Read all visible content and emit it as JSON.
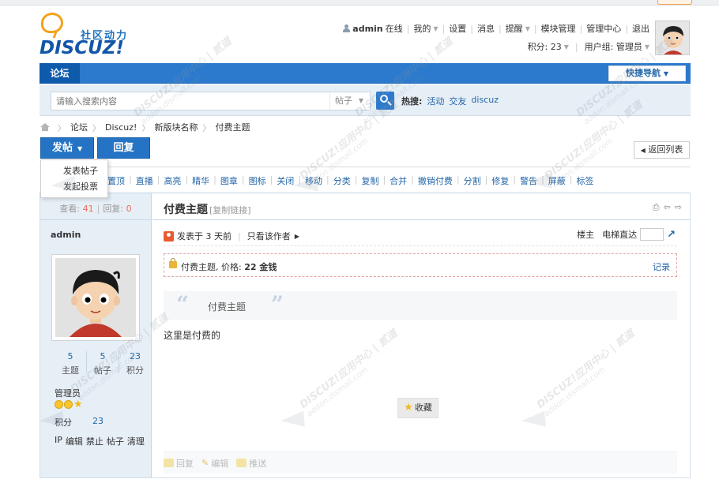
{
  "logo": {
    "cn": "社区动力",
    "en": "DISCUZ!"
  },
  "userbar": {
    "username": "admin",
    "online": "在线",
    "my": "我的",
    "settings": "设置",
    "messages": "消息",
    "reminders": "提醒",
    "module_admin": "模块管理",
    "admin_center": "管理中心",
    "logout": "退出",
    "credits": "积分: 23",
    "usergroup": "用户组: 管理员"
  },
  "nav": {
    "forum": "论坛",
    "quick_nav": "快捷导航"
  },
  "search": {
    "placeholder": "请输入搜索内容",
    "scope": "帖子",
    "hot_label": "热搜:",
    "hot_terms": [
      "活动",
      "交友",
      "discuz"
    ]
  },
  "breadcrumb": [
    "论坛",
    "Discuz!",
    "新版块名称",
    "付费主题"
  ],
  "buttons": {
    "post": "发帖",
    "reply": "回复",
    "return_list": "返回列表"
  },
  "post_menu": [
    "发表帖子",
    "发起投票"
  ],
  "mod_actions": [
    "置顶",
    "直播",
    "高亮",
    "精华",
    "图章",
    "图标",
    "关闭",
    "移动",
    "分类",
    "复制",
    "合并",
    "撤销付费",
    "分割",
    "修复",
    "警告",
    "屏蔽",
    "标签"
  ],
  "thread_stats": {
    "views_label": "查看:",
    "views": "41",
    "replies_label": "回复:",
    "replies": "0"
  },
  "thread": {
    "title": "付费主题",
    "copy_link": "[复制链接]"
  },
  "author": {
    "name": "admin",
    "topics": "5",
    "topics_label": "主题",
    "posts": "5",
    "posts_label": "帖子",
    "credits": "23",
    "credits_label": "积分",
    "group": "管理员",
    "credit_label": "积分",
    "credit_value": "23",
    "admin_links": [
      "IP",
      "编辑",
      "禁止",
      "帖子",
      "清理"
    ]
  },
  "post_meta": {
    "posted": "发表于 3 天前",
    "only_author": "只看该作者",
    "op": "楼主",
    "jump": "电梯直达"
  },
  "paid": {
    "label": "付费主题, 价格:",
    "price": "22 金钱",
    "record": "记录"
  },
  "quote_text": "付费主题",
  "body": "这里是付费的",
  "favorite": "收藏",
  "post_actions": [
    "回复",
    "编辑",
    "推送"
  ],
  "watermark": {
    "main": "DISCUZ!应用中心 | 贰道",
    "sub": "addon.dismall.com"
  }
}
